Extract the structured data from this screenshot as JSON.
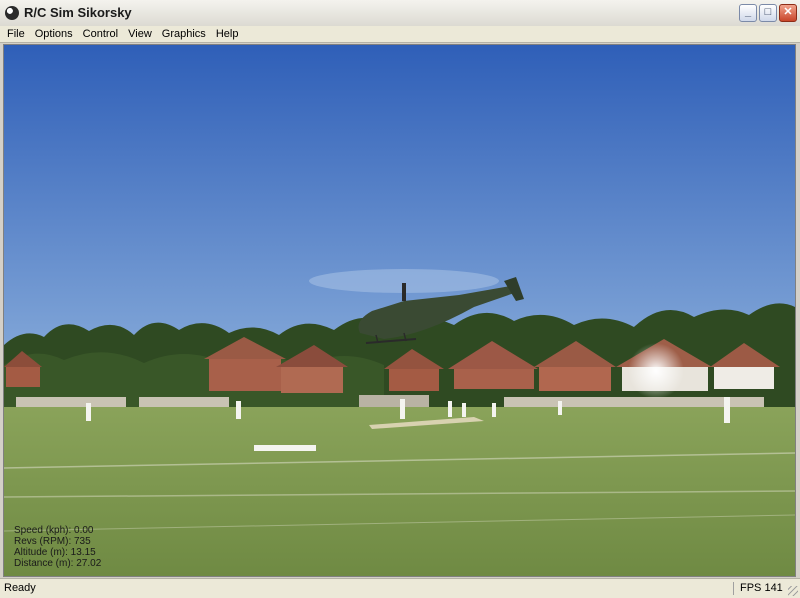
{
  "window": {
    "title": "R/C Sim Sikorsky",
    "icon": "app-logo-icon",
    "controls": {
      "minimize": "_",
      "maximize": "□",
      "close": "✕"
    }
  },
  "menu": [
    "File",
    "Options",
    "Control",
    "View",
    "Graphics",
    "Help"
  ],
  "hud": {
    "speed": "Speed (kph): 0.00",
    "revs": "Revs (RPM): 735",
    "altitude": "Altitude (m): 13.15",
    "distance": "Distance (m): 27.02"
  },
  "status": {
    "left": "Ready",
    "right": "FPS 141"
  },
  "colors": {
    "sky_top": "#2f5fb8",
    "sky_bottom": "#8fb2dd",
    "grass": "#7f9a50",
    "trees": "#2f4a22",
    "house_roof": "#9a5a45",
    "house_wall": "#a8604a"
  }
}
